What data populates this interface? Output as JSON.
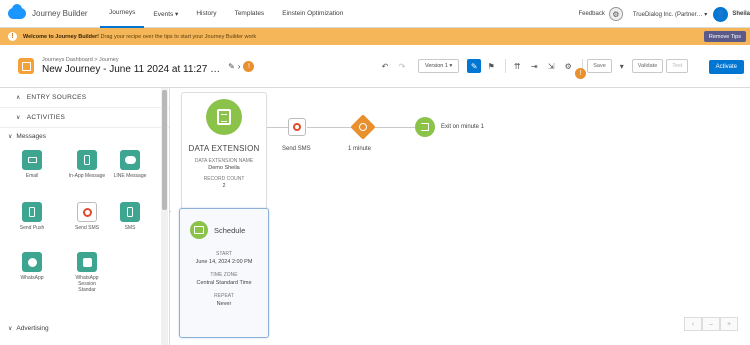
{
  "app": {
    "name": "Journey Builder",
    "nav_tabs": [
      {
        "label": "Journeys",
        "active": true
      },
      {
        "label": "Events ▾",
        "active": false
      },
      {
        "label": "History",
        "active": false
      },
      {
        "label": "Templates",
        "active": false
      },
      {
        "label": "Einstein Optimization",
        "active": false
      }
    ],
    "feedback_label": "Feedback",
    "org_label": "TrueDialog Inc. (Partner…  ▾",
    "user_name": "Sheila"
  },
  "banner": {
    "icon": "info-icon",
    "title": "Welcome to Journey Builder!",
    "text": "Drag your recipe over the tips to start your Journey Builder work",
    "button_label": "Remove Tips",
    "color": "#f4b659"
  },
  "header": {
    "breadcrumb": "Journeys Dashboard > Journey",
    "title": "New Journey - June 11 2024 at 11:27 …",
    "version_label": "Version 1 ▾",
    "save_label": "Save",
    "validate_label": "Validate",
    "test_label": "Test",
    "activate_label": "Activate",
    "pin_marker": "!",
    "accent_color": "#0176d3"
  },
  "sidebar": {
    "entry_sources_label": "ENTRY SOURCES",
    "activities_label": "ACTIVITIES",
    "messages_label": "Messages",
    "advertising_label": "Advertising",
    "activities_rows": [
      [
        {
          "label": "Email",
          "icon": "email-icon"
        },
        {
          "label": "In-App Message",
          "icon": "mobile-icon"
        },
        {
          "label": "LINE Message",
          "icon": "chat-icon"
        }
      ],
      [
        {
          "label": "Send Push",
          "icon": "push-icon"
        },
        {
          "label": "Send SMS",
          "icon": "sms-icon"
        },
        {
          "label": "SMS",
          "icon": "sms-phone-icon"
        }
      ],
      [
        {
          "label": "WhatsApp",
          "icon": "whatsapp-icon"
        },
        {
          "label": "WhatsApp Session Standar",
          "icon": "whatsapp-session-icon"
        }
      ]
    ]
  },
  "canvas": {
    "entry_card": {
      "title": "DATA EXTENSION",
      "de_name_label": "DATA EXTENSION NAME",
      "de_name_value": "Demo Sheila",
      "record_count_label": "RECORD COUNT",
      "record_count_value": "2"
    },
    "schedule_card": {
      "title": "Schedule",
      "start_label": "START",
      "start_value": "June 14, 2024 2:00 PM",
      "timezone_label": "TIME ZONE",
      "timezone_value": "Central Standard Time",
      "repeat_label": "REPEAT",
      "repeat_value": "Never"
    },
    "flow": {
      "sms_label": "Send SMS",
      "wait_label": "1 minute",
      "exit_label": "Exit on minute 1"
    },
    "zoom_controls": [
      "‹",
      "–",
      "+"
    ]
  }
}
